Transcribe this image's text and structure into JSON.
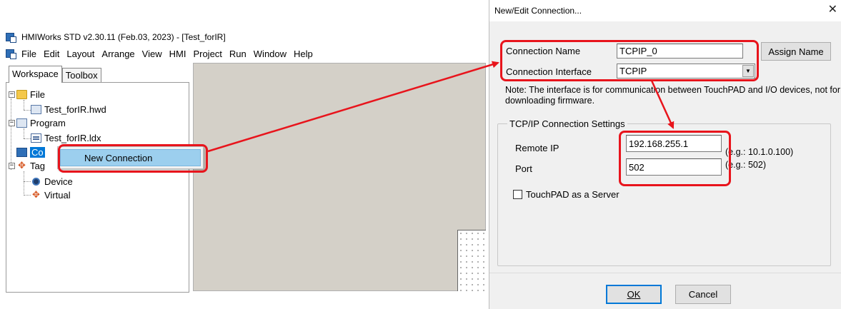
{
  "main_window": {
    "title": "HMIWorks STD v2.30.11 (Feb.03, 2023) - [Test_forIR]",
    "menu": [
      "File",
      "Edit",
      "Layout",
      "Arrange",
      "View",
      "HMI",
      "Project",
      "Run",
      "Window",
      "Help"
    ],
    "tabs": [
      "Workspace",
      "Toolbox"
    ],
    "tree": {
      "file": "File",
      "file_child": "Test_forIR.hwd",
      "program": "Program",
      "program_child": "Test_forIR.ldx",
      "connection_partial": "Co",
      "tags_partial": "Tag",
      "device": "Device",
      "virtual": "Virtual"
    },
    "context_menu": {
      "item": "New Connection"
    }
  },
  "dialog": {
    "title": "New/Edit Connection...",
    "connection_name_label": "Connection Name",
    "connection_name_value": "TCPIP_0",
    "assign_name_button": "Assign Name",
    "connection_interface_label": "Connection Interface",
    "connection_interface_value": "TCPIP",
    "note": "Note: The interface is for communication between TouchPAD and I/O devices, not for downloading firmware.",
    "group_title": "TCP/IP Connection Settings",
    "remote_ip_label": "Remote IP",
    "remote_ip_value": "192.168.255.1",
    "remote_ip_hint": "(e.g.: 10.1.0.100)",
    "port_label": "Port",
    "port_value": "502",
    "port_hint": "(e.g.: 502)",
    "server_checkbox_label": "TouchPAD as a Server",
    "server_checked": false,
    "ok_button": "OK",
    "cancel_button": "Cancel"
  },
  "colors": {
    "highlight": "#e8141c",
    "selection": "#0078d7",
    "context_hover": "#9ccfee"
  }
}
